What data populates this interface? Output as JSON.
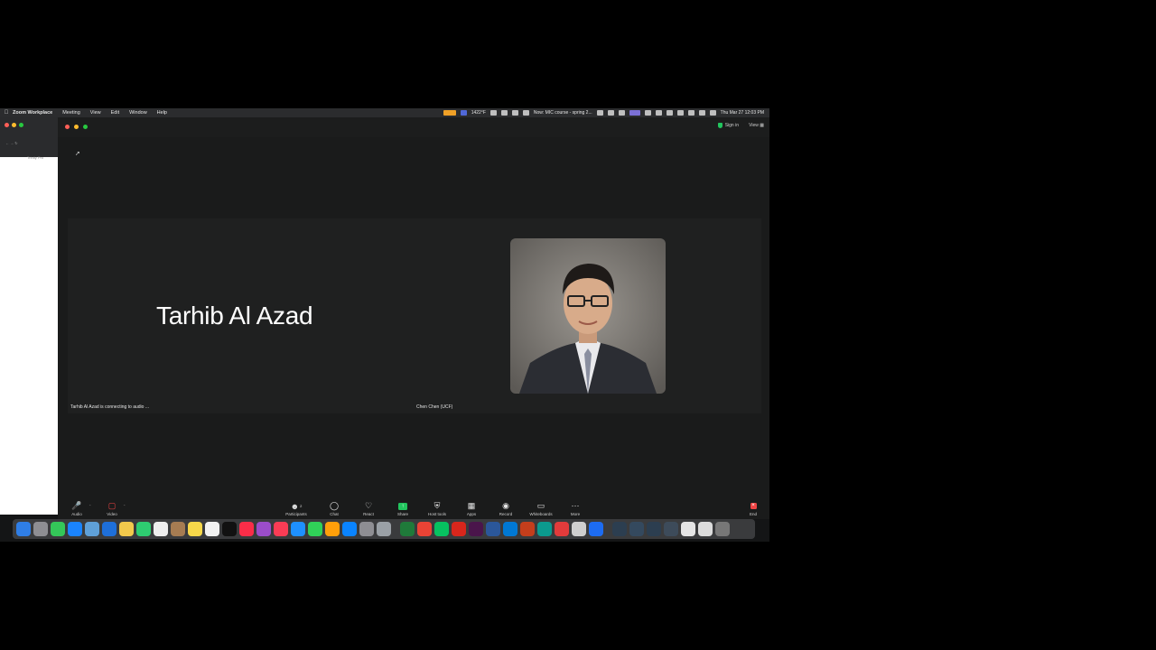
{
  "menubar": {
    "apple_icon": "apple-icon",
    "items": [
      "Zoom Workplace",
      "Meeting",
      "View",
      "Edit",
      "Window",
      "Help"
    ],
    "status_count": "1422°F",
    "now_playing": "Now: MIC course - spring 2...",
    "datetime": "Thu Mar 27  12:03 PM"
  },
  "zoom": {
    "signin_label": "Sign in",
    "view_label": "View",
    "participant_tile": {
      "name": "Tarhib Al Azad",
      "status": "Tarhib Al Azad is connecting to audio ..."
    },
    "video_tile": {
      "name": "Chen Chen (UCF)"
    },
    "toolbar": {
      "audio": "Audio",
      "video": "Video",
      "participants": "Participants",
      "participants_count": "2",
      "chat": "Chat",
      "react": "React",
      "share": "Share",
      "host_tools": "Host tools",
      "apps": "Apps",
      "record": "Record",
      "whiteboards": "Whiteboards",
      "more": "More",
      "end": "End"
    }
  },
  "browser": {
    "tab_label": "Trinity Pro"
  },
  "colors": {
    "share_green": "#22c55e",
    "end_red": "#ef4444",
    "background": "#1a1b1b"
  }
}
